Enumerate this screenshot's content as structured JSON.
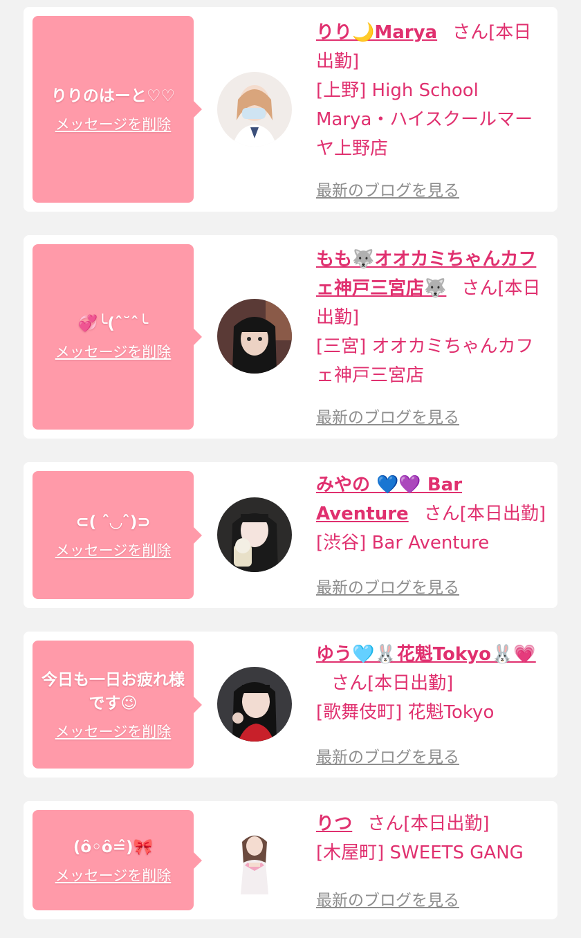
{
  "items": [
    {
      "message": "りりのはーと♡♡",
      "delete_label": "メッセージを削除",
      "name": "りり🌙Marya",
      "suffix": "さん",
      "status": "[本日出勤]",
      "shop": "[上野] High School Marya・ハイスクールマーヤ上野店",
      "blog_label": "最新のブログを見る",
      "avatar_icon": "profile-photo"
    },
    {
      "message": "💞╰(ˆ˘ˆ╰",
      "delete_label": "メッセージを削除",
      "name": "もも🐺オオカミちゃんカフェ神戸三宮店🐺",
      "suffix": "さん",
      "status": "[本日出勤]",
      "shop": "[三宮] オオカミちゃんカフェ神戸三宮店",
      "blog_label": "最新のブログを見る",
      "avatar_icon": "profile-photo"
    },
    {
      "message": "⊂( ˆ◡ˆ)⊃",
      "delete_label": "メッセージを削除",
      "name": "みやの 💙💜 Bar Aventure",
      "suffix": "さん",
      "status": "[本日出勤]",
      "shop": "[渋谷] Bar Aventure",
      "blog_label": "最新のブログを見る",
      "avatar_icon": "profile-photo"
    },
    {
      "message": "今日も一日お疲れ様です😉",
      "delete_label": "メッセージを削除",
      "name": "ゆう🩵🐰花魁Tokyo🐰💗",
      "suffix": "さん",
      "status": "[本日出勤]",
      "shop": "[歌舞伎町] 花魁Tokyo",
      "blog_label": "最新のブログを見る",
      "avatar_icon": "profile-photo"
    },
    {
      "message": "(ȏ◦ȏ=̂)🎀",
      "delete_label": "メッセージを削除",
      "name": "りつ",
      "suffix": "さん",
      "status": "[本日出勤]",
      "shop": "[木屋町] SWEETS GANG",
      "blog_label": "最新のブログを見る",
      "avatar_icon": "profile-photo"
    }
  ],
  "colors": {
    "bubble": "#ff9aa9",
    "accent": "#e0306f",
    "link_gray": "#8e8e8e",
    "background": "#f2f2f2"
  }
}
